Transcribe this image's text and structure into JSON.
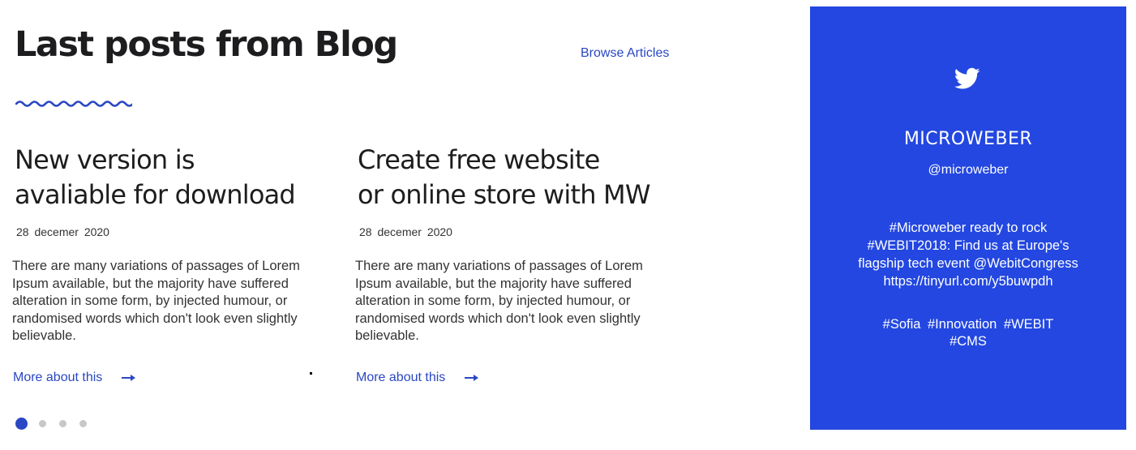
{
  "blog": {
    "heading": "Last posts from Blog",
    "browse_label": "Browse Articles",
    "accent_color": "#2a47c4"
  },
  "posts": [
    {
      "title_lines": [
        "New version is",
        "avaliable for download"
      ],
      "date": "28 decemer 2020",
      "text_lines": [
        "There are many variations of passages of Lorem",
        "Ipsum available, but the majority have suffered",
        "alteration in some form, by injected humour, or",
        "randomised words which don't look even slightly",
        "believable."
      ],
      "more_label": "More about this"
    },
    {
      "title_lines": [
        "Create free website",
        "or online store with MW"
      ],
      "date": "28 decemer 2020",
      "text_lines": [
        "There are many variations of passages of Lorem",
        "Ipsum available, but the majority have suffered",
        "alteration in some form, by injected humour, or",
        "randomised words which don't look even slightly",
        "believable."
      ],
      "more_label": "More about this"
    }
  ],
  "pagination": {
    "count": 4,
    "active_index": 0
  },
  "twitter": {
    "icon": "twitter-bird-icon",
    "brand": "MICROWEBER",
    "handle": "@microweber",
    "tweet_lines": [
      "#Microweber ready to rock",
      "#WEBIT2018: Find us at Europe's",
      "flagship tech event @WebitCongress",
      "https://tinyurl.com/y5buwpdh"
    ],
    "tag_lines": [
      "#Sofia  #Innovation  #WEBIT",
      "#CMS"
    ],
    "background_color": "#2347e0"
  }
}
